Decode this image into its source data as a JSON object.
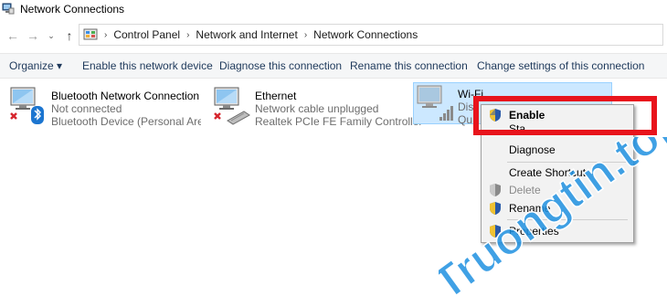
{
  "window": {
    "title": "Network Connections"
  },
  "address": {
    "crumbs": [
      "Control Panel",
      "Network and Internet",
      "Network Connections"
    ]
  },
  "commandbar": {
    "organize": "Organize ▾",
    "enable_device": "Enable this network device",
    "diagnose": "Diagnose this connection",
    "rename": "Rename this connection",
    "change_settings": "Change settings of this connection"
  },
  "adapters": [
    {
      "name": "Bluetooth Network Connection",
      "status": "Not connected",
      "device": "Bluetooth Device (Personal Area ..."
    },
    {
      "name": "Ethernet",
      "status": "Network cable unplugged",
      "device": "Realtek PCIe FE Family Controller"
    },
    {
      "name": "Wi-Fi",
      "status": "Dis",
      "device": "Qu"
    }
  ],
  "context_menu": {
    "items": [
      {
        "label": "Enable"
      },
      {
        "label": "Sta"
      },
      {
        "label": "Diagnose"
      },
      {
        "label": "Create Shortcut"
      },
      {
        "label": "Delete"
      },
      {
        "label": "Rename"
      },
      {
        "label": "Properties"
      }
    ]
  },
  "watermark": {
    "text": "Truongtin.top"
  },
  "colors": {
    "highlight": "#e8141c",
    "selection": "#cce8ff",
    "watermark_blue": "#1e90e0",
    "watermark_orange": "#f39c12"
  }
}
